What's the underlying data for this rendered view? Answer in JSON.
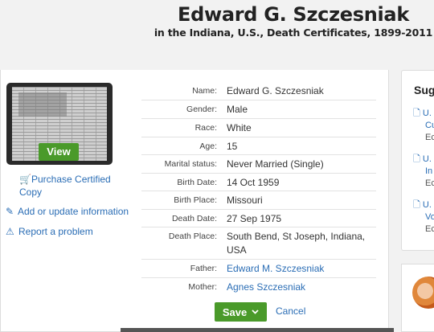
{
  "header": {
    "title": "Edward G. Szczesniak",
    "subtitle": "in the Indiana, U.S., Death Certificates, 1899-2011"
  },
  "thumbnail": {
    "view_label": "View"
  },
  "side_links": {
    "purchase": "Purchase Certified Copy",
    "add_update": "Add or update information",
    "report": "Report a problem"
  },
  "record": {
    "rows": [
      {
        "label": "Name:",
        "value": "Edward G. Szczesniak"
      },
      {
        "label": "Gender:",
        "value": "Male"
      },
      {
        "label": "Race:",
        "value": "White"
      },
      {
        "label": "Age:",
        "value": "15"
      },
      {
        "label": "Marital status:",
        "value": "Never Married (Single)"
      },
      {
        "label": "Birth Date:",
        "value": "14 Oct 1959"
      },
      {
        "label": "Birth Place:",
        "value": "Missouri"
      },
      {
        "label": "Death Date:",
        "value": "27 Sep 1975"
      },
      {
        "label": "Death Place:",
        "value": "South Bend, St Joseph, Indiana, USA"
      },
      {
        "label": "Father:",
        "value": "Edward M. Szczesniak"
      },
      {
        "label": "Mother:",
        "value": "Agnes Szczesniak"
      }
    ]
  },
  "actions": {
    "save_label": "Save",
    "cancel_label": "Cancel"
  },
  "suggestions": {
    "title": "Sug",
    "items": [
      {
        "line1": "U.",
        "line2": "Cu",
        "line3": "Ec"
      },
      {
        "line1": "U.",
        "line2": "In",
        "line3": "Ec"
      },
      {
        "line1": "U.",
        "line2": "Vo",
        "line3": "Ec"
      }
    ]
  },
  "colors": {
    "accent_green": "#4a9a2a",
    "link_blue": "#2a6db5"
  }
}
